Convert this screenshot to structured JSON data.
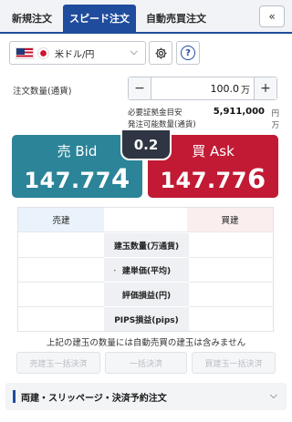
{
  "tabs": {
    "new_order": "新規注文",
    "speed_order": "スピード注文",
    "auto_trade_order": "自動売買注文"
  },
  "collapse_glyph": "«",
  "pair": {
    "label": "米ドル/円",
    "chevron": "⌵"
  },
  "help_glyph": "?",
  "quantity": {
    "label": "注文数量(通貨)",
    "minus": "−",
    "plus": "+",
    "value": "100.0",
    "unit": "万"
  },
  "margin": {
    "required_label": "必要証拠金目安",
    "required_value": "5,911,000",
    "required_unit": "円",
    "available_label": "発注可能数量(通貨)",
    "available_unit": "万"
  },
  "bid": {
    "label": "売 Bid",
    "prefix": "147.77",
    "suffix": "4"
  },
  "ask": {
    "label": "買 Ask",
    "prefix": "147.77",
    "suffix": "6"
  },
  "spread": "0.2",
  "positions": {
    "sell_header": "売建",
    "buy_header": "買建",
    "rows": [
      "建玉数量(万通貨)",
      "建単価(平均)",
      "評価損益(円)",
      "PIPS損益(pips)"
    ]
  },
  "note": "上記の建玉の数量には自動売買の建玉は含みません",
  "close_buttons": {
    "sell_close_all": "売建玉一括決済",
    "close_all": "一括決済",
    "buy_close_all": "買建玉一括決済"
  },
  "footer": {
    "label": "両建・スリッページ・決済予約注文",
    "chevron": "⌵"
  },
  "colors": {
    "brand": "#1f4c9c",
    "bid": "#2b8498",
    "ask": "#c21a34",
    "spread_bg": "#2f3542"
  }
}
